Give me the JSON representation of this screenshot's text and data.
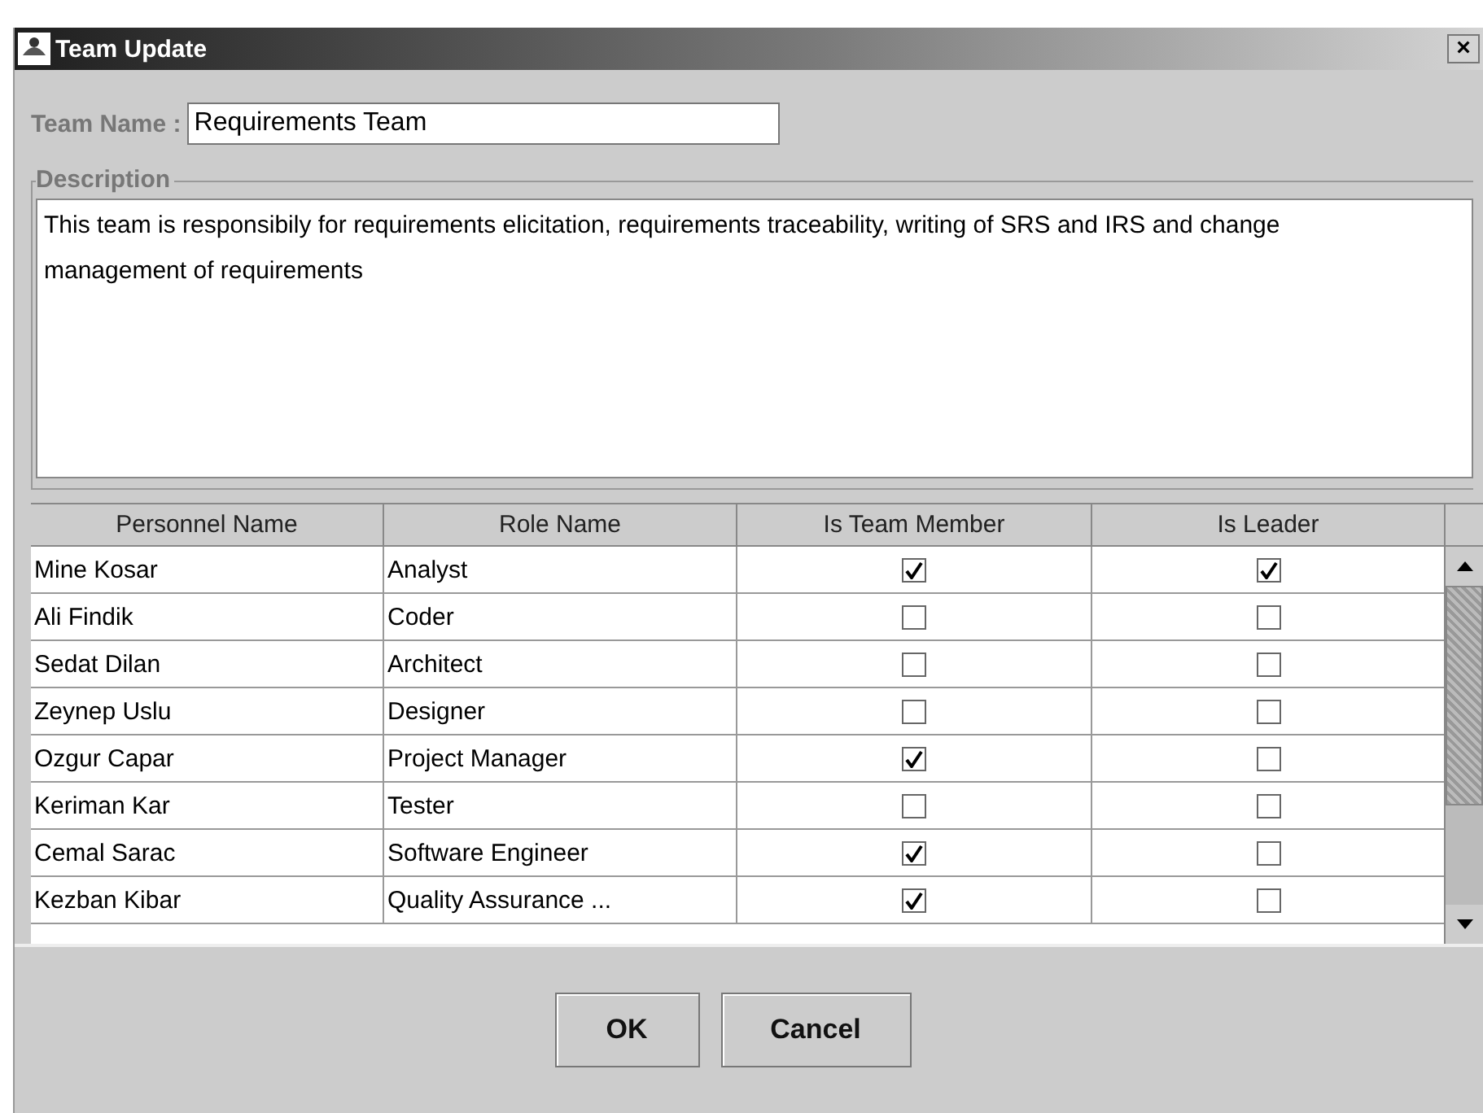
{
  "window": {
    "title": "Team Update",
    "close": "×"
  },
  "team_name": {
    "label": "Team Name :",
    "value": "Requirements Team"
  },
  "description": {
    "label": "Description",
    "value": "This team is responsibily for requirements elicitation, requirements traceability, writing of SRS and IRS and change management of requirements"
  },
  "table": {
    "columns": [
      "Personnel Name",
      "Role Name",
      "Is Team Member",
      "Is Leader"
    ],
    "rows": [
      {
        "name": "Mine Kosar",
        "role": "Analyst",
        "member": true,
        "leader": true
      },
      {
        "name": "Ali Findik",
        "role": "Coder",
        "member": false,
        "leader": false
      },
      {
        "name": "Sedat Dilan",
        "role": "Architect",
        "member": false,
        "leader": false
      },
      {
        "name": "Zeynep Uslu",
        "role": "Designer",
        "member": false,
        "leader": false
      },
      {
        "name": "Ozgur Capar",
        "role": "Project Manager",
        "member": true,
        "leader": false
      },
      {
        "name": "Keriman Kar",
        "role": "Tester",
        "member": false,
        "leader": false
      },
      {
        "name": "Cemal Sarac",
        "role": "Software Engineer",
        "member": true,
        "leader": false
      },
      {
        "name": "Kezban Kibar",
        "role": "Quality Assurance ...",
        "member": true,
        "leader": false
      }
    ]
  },
  "buttons": [
    "OK",
    "Cancel"
  ]
}
